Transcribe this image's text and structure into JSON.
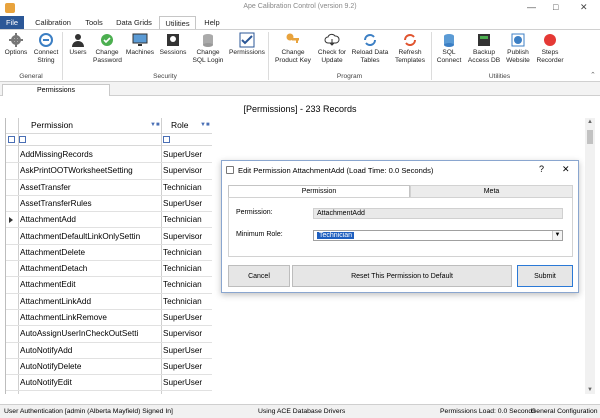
{
  "window": {
    "title": "Ape Calibration Control (version 9.2)",
    "minimize_icon": "minimize-icon",
    "maximize_icon": "maximize-icon",
    "close_icon": "close-icon"
  },
  "ribbon_tabs": [
    "File",
    "Calibration",
    "Tools",
    "Data Grids",
    "Utilities",
    "Help"
  ],
  "ribbon": {
    "groups": [
      {
        "label": "General",
        "buttons": [
          {
            "label": "Options",
            "icon": "gear-icon"
          },
          {
            "label": "Connect String",
            "icon": "connect-icon"
          }
        ]
      },
      {
        "label": "Security",
        "buttons": [
          {
            "label": "Users",
            "icon": "users-icon"
          },
          {
            "label": "Change Password",
            "icon": "password-icon"
          },
          {
            "label": "Machines",
            "icon": "monitor-icon"
          },
          {
            "label": "Sessions",
            "icon": "sessions-icon"
          },
          {
            "label": "Change SQL Login",
            "icon": "database-icon"
          },
          {
            "label": "Permissions",
            "icon": "checkmark-icon"
          }
        ]
      },
      {
        "label": "Program",
        "buttons": [
          {
            "label": "Change Product Key",
            "icon": "key-icon"
          },
          {
            "label": "Check for Update",
            "icon": "cloud-download-icon"
          },
          {
            "label": "Reload Data Tables",
            "icon": "reload-icon"
          },
          {
            "label": "Refresh Templates",
            "icon": "refresh-icon"
          }
        ]
      },
      {
        "label": "Utilities",
        "buttons": [
          {
            "label": "SQL Connect",
            "icon": "sql-icon"
          },
          {
            "label": "Backup Access DB",
            "icon": "backup-icon"
          },
          {
            "label": "Publish Website",
            "icon": "publish-icon"
          },
          {
            "label": "Steps Recorder",
            "icon": "record-icon"
          }
        ]
      }
    ]
  },
  "doc_tab": "Permissions",
  "grid": {
    "title": "[Permissions] - 233 Records",
    "columns": [
      "Permission",
      "Role"
    ],
    "rows": [
      {
        "permission": "AddMissingRecords",
        "role": "SuperUser"
      },
      {
        "permission": "AskPrintOOTWorksheetSetting",
        "role": "Supervisor"
      },
      {
        "permission": "AssetTransfer",
        "role": "Technician"
      },
      {
        "permission": "AssetTransferRules",
        "role": "SuperUser"
      },
      {
        "permission": "AttachmentAdd",
        "role": "Technician",
        "selected": true
      },
      {
        "permission": "AttachmentDefaultLinkOnlySettin",
        "role": "Supervisor"
      },
      {
        "permission": "AttachmentDelete",
        "role": "Technician"
      },
      {
        "permission": "AttachmentDetach",
        "role": "Technician"
      },
      {
        "permission": "AttachmentEdit",
        "role": "Technician"
      },
      {
        "permission": "AttachmentLinkAdd",
        "role": "Technician"
      },
      {
        "permission": "AttachmentLinkRemove",
        "role": "SuperUser"
      },
      {
        "permission": "AutoAssignUserInCheckOutSetti",
        "role": "Supervisor"
      },
      {
        "permission": "AutoNotifyAdd",
        "role": "SuperUser"
      },
      {
        "permission": "AutoNotifyDelete",
        "role": "SuperUser"
      },
      {
        "permission": "AutoNotifyEdit",
        "role": "SuperUser"
      }
    ]
  },
  "dialog": {
    "title": "Edit Permission AttachmentAdd (Load Time: 0.0 Seconds)",
    "help": "?",
    "close": "✕",
    "tabs": [
      "Permission",
      "Meta"
    ],
    "permission_label": "Permission:",
    "permission_value": "AttachmentAdd",
    "role_label": "Minimum Role:",
    "role_value": "Technician",
    "buttons": {
      "cancel": "Cancel",
      "reset": "Reset This Permission to Default",
      "submit": "Submit"
    }
  },
  "status": {
    "auth": "User Authentication [admin (Alberta Mayfield) Signed In]",
    "driver": "Using ACE Database Drivers",
    "load": "Permissions Load: 0.0 Seconds",
    "config": "General Configuration"
  },
  "colors": {
    "file_tab": "#2b5797",
    "accent": "#2b5797",
    "selected_field": "#1f5fbf"
  }
}
